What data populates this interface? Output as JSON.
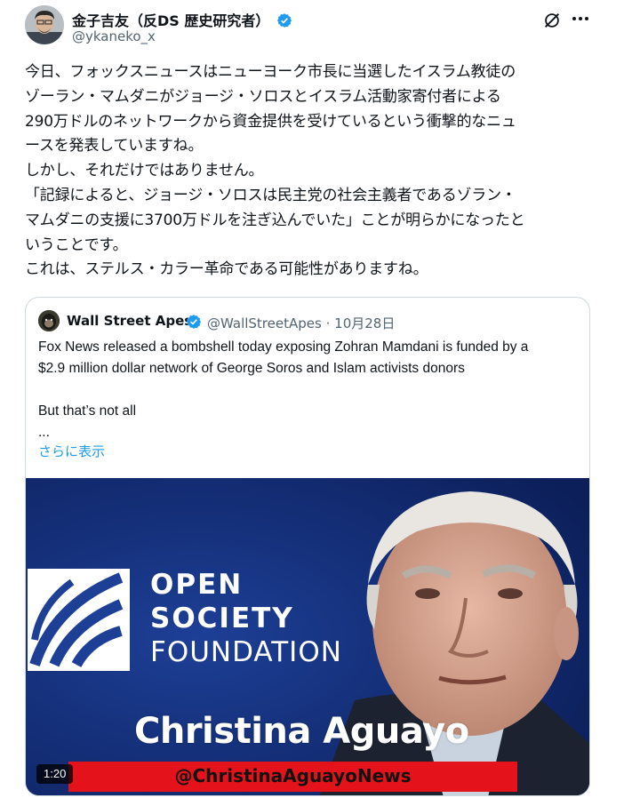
{
  "tweet": {
    "author_name": "金子吉友（反DS 歴史研究者）",
    "author_handle": "@ykaneko_x",
    "text": "今日、フォックスニュースはニューヨーク市長に当選したイスラム教徒の\nゾーラン・マムダニがジョージ・ソロスとイスラム活動家寄付者による\n290万ドルのネットワークから資金提供を受けているという衝撃的なニュ\nースを発表していますね。\nしかし、それだけではありません。\n「記録によると、ジョージ・ソロスは民主党の社会主義者であるゾラン・\nマムダニの支援に3700万ドルを注ぎ込んでいた」ことが明らかになったと\nいうことです。\nこれは、ステルス・カラー革命である可能性がありますね。"
  },
  "quote": {
    "author_name": "Wall Street Apes",
    "author_handle": "@WallStreetApes",
    "separator": "·",
    "date": "10月28日",
    "text": "Fox News released a bombshell today exposing Zohran Mamdani is funded by a\n$2.9 million dollar network of George Soros and Islam activists donors\n\nBut that’s not all\n...",
    "show_more": "さらに表示"
  },
  "media": {
    "logo_line1": "OPEN",
    "logo_line2": "SOCIETY",
    "logo_line3": "FOUNDATION",
    "watermark": "Christina Aguayo",
    "banner": "@ChristinaAguayoNews",
    "duration": "1:20"
  },
  "icons": {
    "verified": "verified-badge-icon",
    "grok": "grok-icon",
    "more": "more-icon"
  },
  "colors": {
    "accent": "#1d9bf0",
    "text": "#0f1419",
    "muted": "#536471",
    "banner_red": "#e3121b",
    "media_blue": "#122a6e"
  }
}
